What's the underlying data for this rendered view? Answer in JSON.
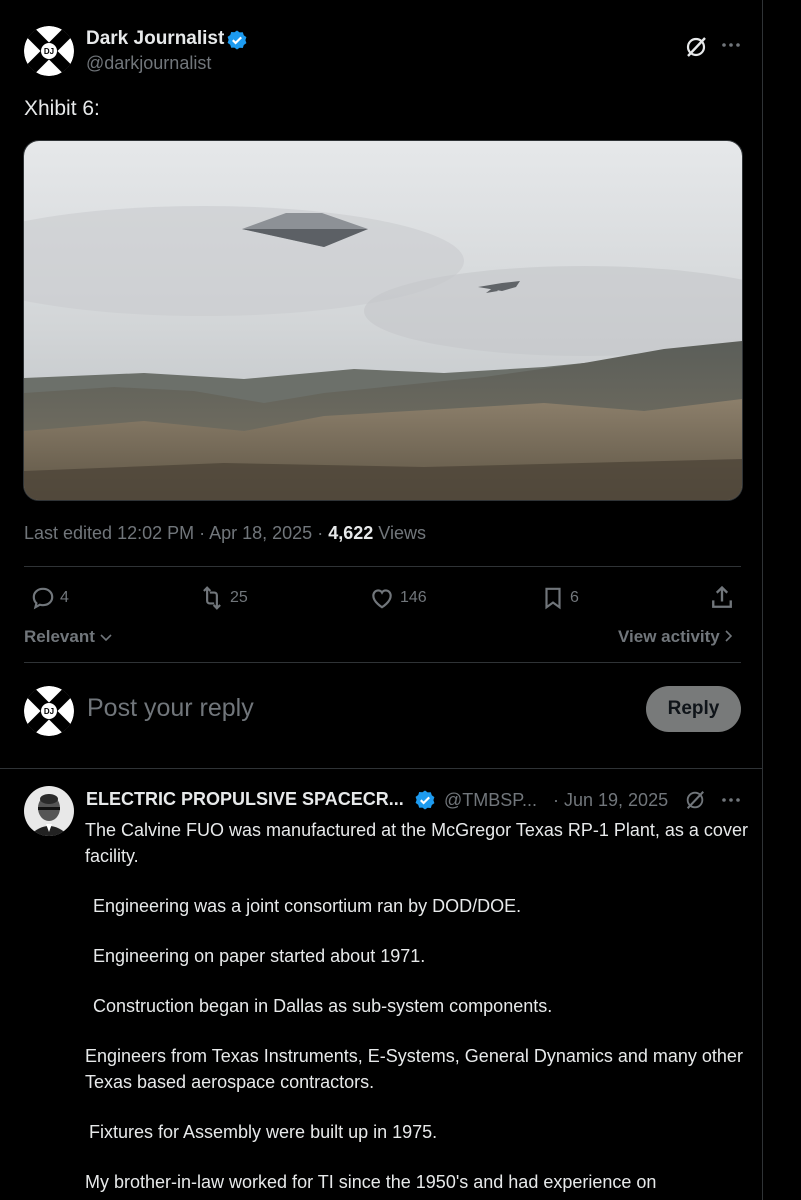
{
  "post": {
    "author_name": "Dark Journalist",
    "author_handle": "@darkjournalist",
    "avatar_text": "DJ",
    "text": "Xhibit 6:",
    "edited_label": "Last edited 12:02 PM · Apr 18, 2025 ·",
    "views_count": "4,622",
    "views_label": "Views",
    "stats": {
      "replies": "4",
      "reposts": "25",
      "likes": "146",
      "bookmarks": "6"
    }
  },
  "sort": {
    "label": "Relevant",
    "view_activity": "View activity"
  },
  "composer": {
    "placeholder": "Post your reply",
    "reply_button": "Reply"
  },
  "reply": {
    "author_name": "ELECTRIC PROPULSIVE SPACECR...",
    "author_handle": "@TMBSP...",
    "date": "· Jun 19, 2025",
    "paragraphs": [
      "The Calvine FUO was manufactured at the McGregor Texas RP-1 Plant, as a cover facility.",
      "Engineering was a joint consortium ran by DOD/DOE.",
      "Engineering on paper started about 1971.",
      "Construction began in Dallas as sub-system components.",
      "Engineers from Texas Instruments, E-Systems, General Dynamics and many other Texas based aerospace contractors.",
      "Fixtures for Assembly were built up in 1975.",
      "My brother-in-law worked for TI since the 1950's and had experience on"
    ]
  },
  "colors": {
    "verified": "#1d9bf0",
    "muted": "#71767b",
    "divider": "#2f3336",
    "reply_button_bg": "#787a7a"
  }
}
